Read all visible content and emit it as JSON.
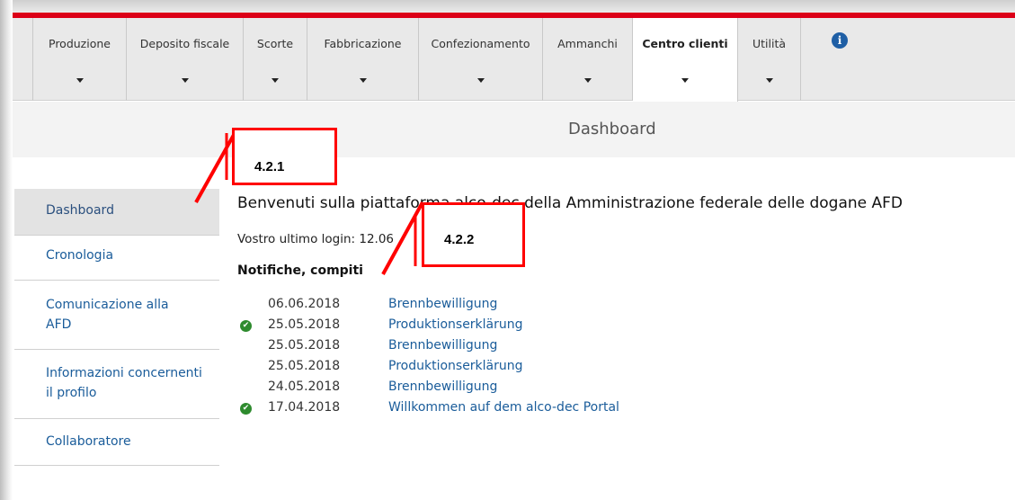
{
  "nav": {
    "items": [
      {
        "label": "Produzione"
      },
      {
        "label": "Deposito fiscale"
      },
      {
        "label": "Scorte"
      },
      {
        "label": "Fabbricazione"
      },
      {
        "label": "Confezionamento"
      },
      {
        "label": "Ammanchi"
      },
      {
        "label": "Centro clienti",
        "active": true
      },
      {
        "label": "Utilità"
      }
    ],
    "info_icon": "info-icon"
  },
  "page": {
    "title": "Dashboard"
  },
  "sidebar": {
    "items": [
      {
        "label": "Dashboard",
        "active": true
      },
      {
        "label": "Cronologia"
      },
      {
        "label": "Comunicazione alla AFD"
      },
      {
        "label": "Informazioni concernenti il profilo"
      },
      {
        "label": "Collaboratore"
      }
    ]
  },
  "main": {
    "welcome": "Benvenuti sulla piattaforma alco-dec della Amministrazione federale delle dogane AFD",
    "last_login": "Vostro ultimo login: 12.06",
    "notifications_heading": "Notifiche, compiti",
    "notifications": [
      {
        "date": "06.06.2018",
        "title": "Brennbewilligung",
        "done": false
      },
      {
        "date": "25.05.2018",
        "title": "Produktionserklärung",
        "done": true
      },
      {
        "date": "25.05.2018",
        "title": "Brennbewilligung",
        "done": false
      },
      {
        "date": "25.05.2018",
        "title": "Produktionserklärung",
        "done": false
      },
      {
        "date": "24.05.2018",
        "title": "Brennbewilligung",
        "done": false
      },
      {
        "date": "17.04.2018",
        "title": "Willkommen auf dem alco-dec Portal",
        "done": true
      }
    ]
  },
  "annotations": [
    {
      "label": "4.2.1"
    },
    {
      "label": "4.2.2"
    }
  ],
  "colors": {
    "accent_red": "#dc0018",
    "link_blue": "#1a5c9a",
    "check_green": "#2e8b2e",
    "annotation_red": "#ff0000"
  }
}
